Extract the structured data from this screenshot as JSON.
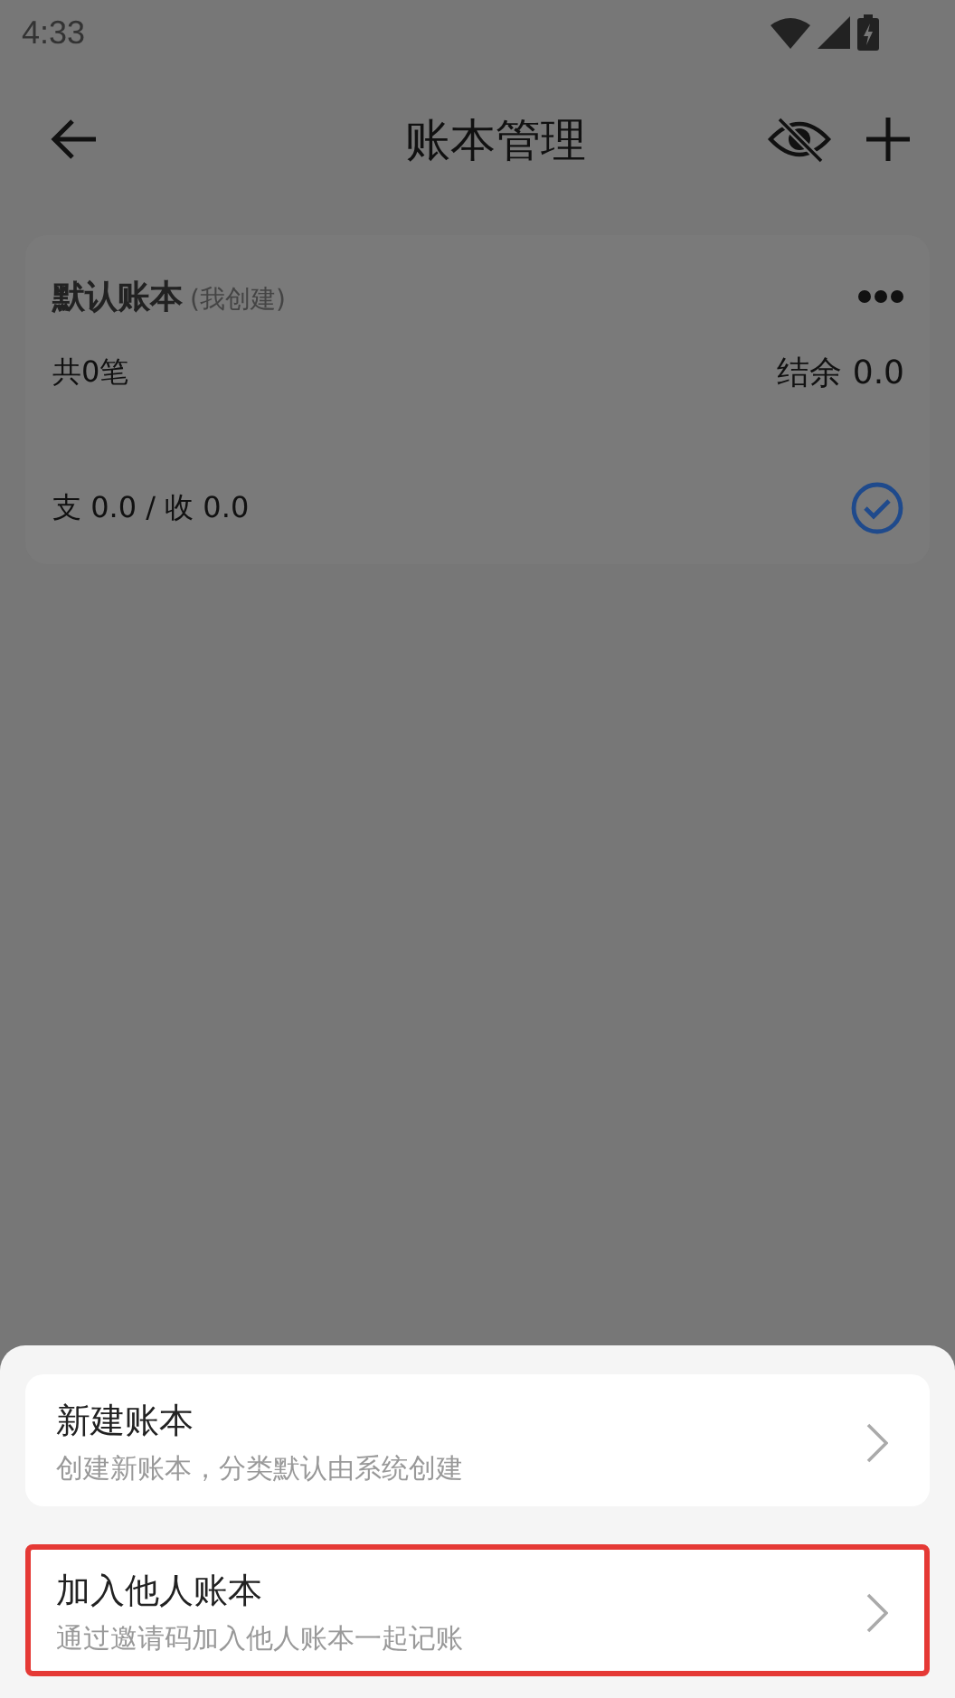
{
  "status_bar": {
    "time": "4:33"
  },
  "toolbar": {
    "title": "账本管理"
  },
  "books": [
    {
      "name": "默认账本",
      "owner_note": "(我创建)",
      "count": "共0笔",
      "balance": "结余 0.0",
      "totals": "支 0.0 / 收 0.0",
      "selected": true
    }
  ],
  "sheet": {
    "options": [
      {
        "title": "新建账本",
        "subtitle": "创建新账本，分类默认由系统创建",
        "highlighted": false
      },
      {
        "title": "加入他人账本",
        "subtitle": "通过邀请码加入他人账本一起记账",
        "highlighted": true
      }
    ]
  }
}
